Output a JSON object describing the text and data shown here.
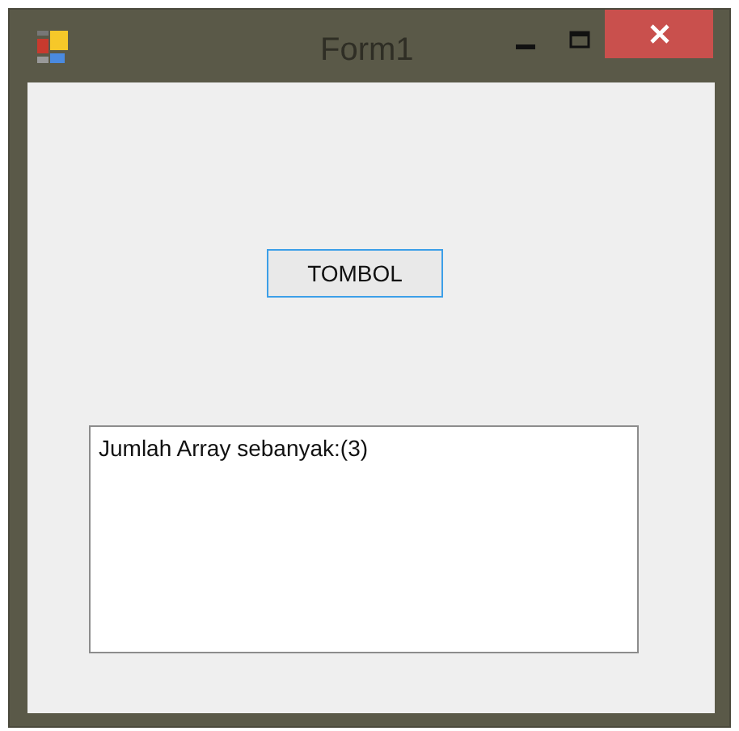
{
  "window": {
    "title": "Form1"
  },
  "button": {
    "label": "TOMBOL"
  },
  "listbox": {
    "items": [
      "Jumlah Array sebanyak:(3)"
    ]
  }
}
